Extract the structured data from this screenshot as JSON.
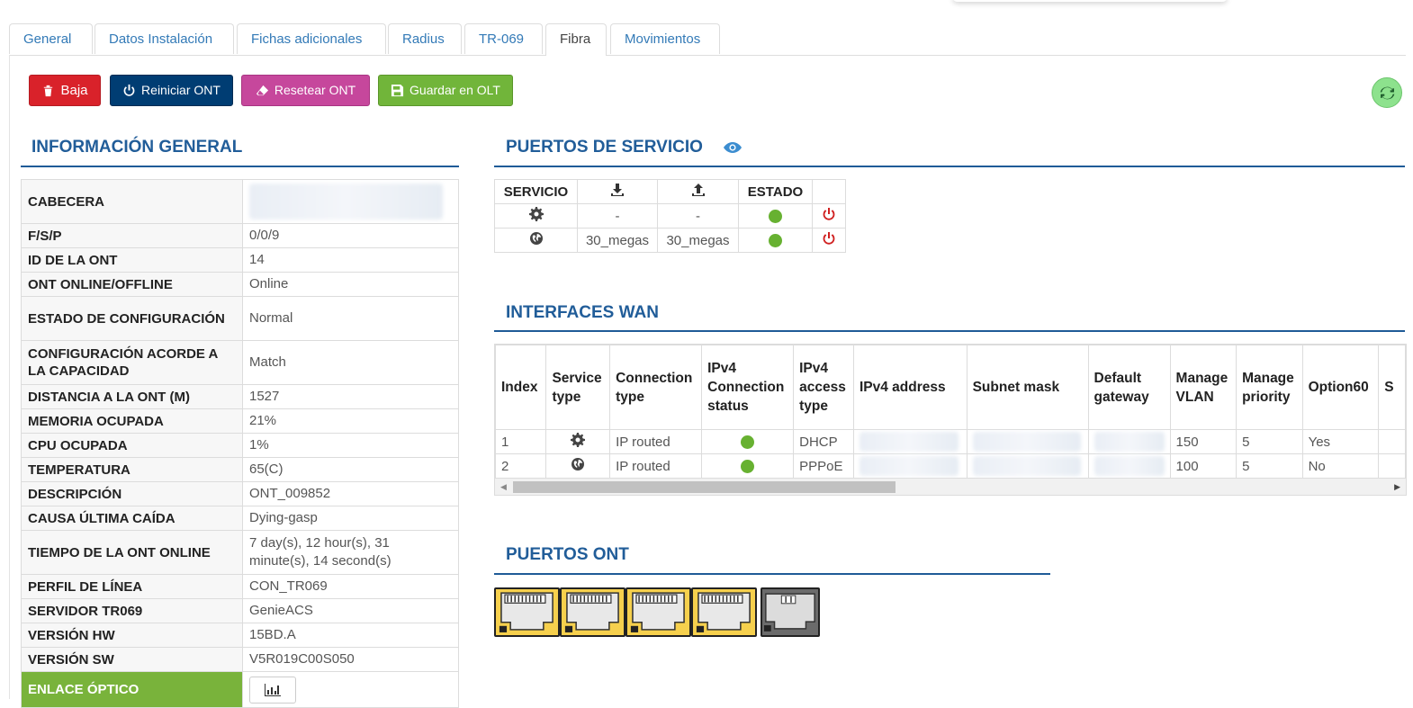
{
  "tabs": [
    "General",
    "Datos Instalación",
    "Fichas adicionales",
    "Radius",
    "TR-069",
    "Fibra",
    "Movimientos"
  ],
  "active_tab": "Fibra",
  "actions": {
    "baja": "Baja",
    "reiniciar": "Reiniciar ONT",
    "resetear": "Resetear ONT",
    "guardar": "Guardar en OLT"
  },
  "colors": {
    "baja": "#d9222a",
    "reiniciar": "#003d73",
    "resetear": "#c6479c",
    "guardar": "#71b53a",
    "header": "#215d99",
    "online_dot": "#67b131",
    "power_icon": "#d02020"
  },
  "info": {
    "title": "INFORMACIÓN GENERAL",
    "rows": [
      {
        "k": "CABECERA",
        "v": ""
      },
      {
        "k": "F/S/P",
        "v": "0/0/9"
      },
      {
        "k": "ID DE LA ONT",
        "v": "14"
      },
      {
        "k": "ONT ONLINE/OFFLINE",
        "v": "Online"
      },
      {
        "k": "ESTADO DE CONFIGURACIÓN",
        "v": "Normal"
      },
      {
        "k": "CONFIGURACIÓN ACORDE A LA CAPACIDAD",
        "v": "Match"
      },
      {
        "k": "DISTANCIA A LA ONT (M)",
        "v": "1527"
      },
      {
        "k": "MEMORIA OCUPADA",
        "v": "21%"
      },
      {
        "k": "CPU OCUPADA",
        "v": "1%"
      },
      {
        "k": "TEMPERATURA",
        "v": "65(C)"
      },
      {
        "k": "DESCRIPCIÓN",
        "v": "ONT_009852"
      },
      {
        "k": "CAUSA ÚLTIMA CAÍDA",
        "v": "Dying-gasp"
      },
      {
        "k": "TIEMPO DE LA ONT ONLINE",
        "v": "7 day(s), 12 hour(s), 31 minute(s), 14 second(s)"
      },
      {
        "k": "PERFIL DE LÍNEA",
        "v": "CON_TR069"
      },
      {
        "k": "SERVIDOR TR069",
        "v": "GenieACS"
      },
      {
        "k": "VERSIÓN HW",
        "v": "15BD.A"
      },
      {
        "k": "VERSIÓN SW",
        "v": "V5R019C00S050"
      },
      {
        "k": "ENLACE ÓPTICO",
        "v": ""
      }
    ]
  },
  "service": {
    "title": "PUERTOS DE SERVICIO",
    "headers": [
      "SERVICIO",
      "download-icon",
      "upload-icon",
      "ESTADO",
      ""
    ],
    "rows": [
      {
        "icon": "gear-icon",
        "down": "-",
        "up": "-",
        "estado": "online"
      },
      {
        "icon": "globe-icon",
        "down": "30_megas",
        "up": "30_megas",
        "estado": "online"
      }
    ]
  },
  "wan": {
    "title": "INTERFACES WAN",
    "headers": [
      "Index",
      "Service type",
      "Connection type",
      "IPv4 Connection status",
      "IPv4 access type",
      "IPv4 address",
      "Subnet mask",
      "Default gateway",
      "Manage VLAN",
      "Manage priority",
      "Option60",
      "S"
    ],
    "rows": [
      {
        "index": "1",
        "service": "gear-icon",
        "conn": "IP routed",
        "status": "online",
        "access": "DHCP",
        "vlan": "150",
        "priority": "5",
        "opt60": "Yes"
      },
      {
        "index": "2",
        "service": "globe-icon",
        "conn": "IP routed",
        "status": "online",
        "access": "PPPoE",
        "vlan": "100",
        "priority": "5",
        "opt60": "No"
      }
    ]
  },
  "ports": {
    "title": "PUERTOS ONT",
    "states": [
      "active",
      "active",
      "active",
      "active",
      "inactive"
    ]
  }
}
